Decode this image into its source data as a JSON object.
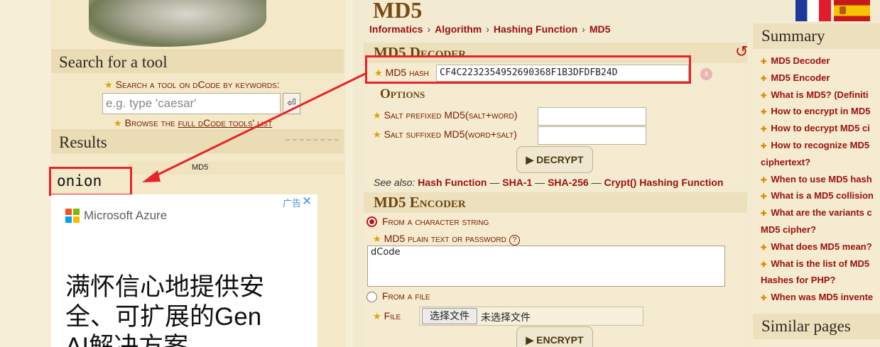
{
  "left": {
    "search_heading": "Search for a tool",
    "search_keywords_label": "Search a tool on dCode by keywords:",
    "search_placeholder": "e.g. type 'caesar'",
    "search_button_icon": "enter-icon",
    "browse_prefix": "Browse the ",
    "browse_link": "full dCode tools' list",
    "results_heading": "Results",
    "result_tool": "MD5",
    "result_value": "onion"
  },
  "ad": {
    "brand": "Microsoft Azure",
    "label": "广告",
    "close": "✕",
    "headline": "满怀信心地提供安全、可扩展的Gen AI解决方案"
  },
  "page": {
    "title": "MD5",
    "breadcrumb": [
      "Informatics",
      "Algorithm",
      "Hashing Function",
      "MD5"
    ]
  },
  "decoder": {
    "heading": "MD5 Decoder",
    "hash_label": "MD5 hash",
    "hash_value": "CF4C2232354952690368F1B3DFDFB24D",
    "options_title": "Options",
    "salt_prefixed_label": "Salt prefixed MD5(salt+word)",
    "salt_suffixed_label": "Salt suffixed MD5(word+salt)",
    "decrypt_label": "▶ DECRYPT",
    "see_also_label": "See also:",
    "see_also_links": [
      "Hash Function",
      "SHA-1",
      "SHA-256",
      "Crypt() Hashing Function"
    ]
  },
  "encoder": {
    "heading": "MD5 Encoder",
    "from_string_label": "From a character string",
    "plain_label": "MD5 plain text or password",
    "plain_value": "dCode",
    "from_file_label": "From a file",
    "file_label": "File",
    "file_button": "选择文件",
    "file_none": "未选择文件",
    "encrypt_label": "▶ ENCRYPT"
  },
  "right": {
    "summary_heading": "Summary",
    "summary_items": [
      "MD5 Decoder",
      "MD5 Encoder",
      "What is MD5? (Definiti",
      "How to encrypt in MD5",
      "How to decrypt MD5 ci",
      "How to recognize MD5",
      "ciphertext?",
      "When to use MD5 hash",
      "What is a MD5 collision",
      "What are the variants c",
      "MD5 cipher?",
      "What does MD5 mean?",
      "What is the list of MD5",
      "Hashes for PHP?",
      "When was MD5 invente"
    ],
    "similar_heading": "Similar pages"
  },
  "colors": {
    "highlight_red": "#e8232a",
    "link_red": "#9a1010",
    "section_brown": "#6b4612"
  }
}
